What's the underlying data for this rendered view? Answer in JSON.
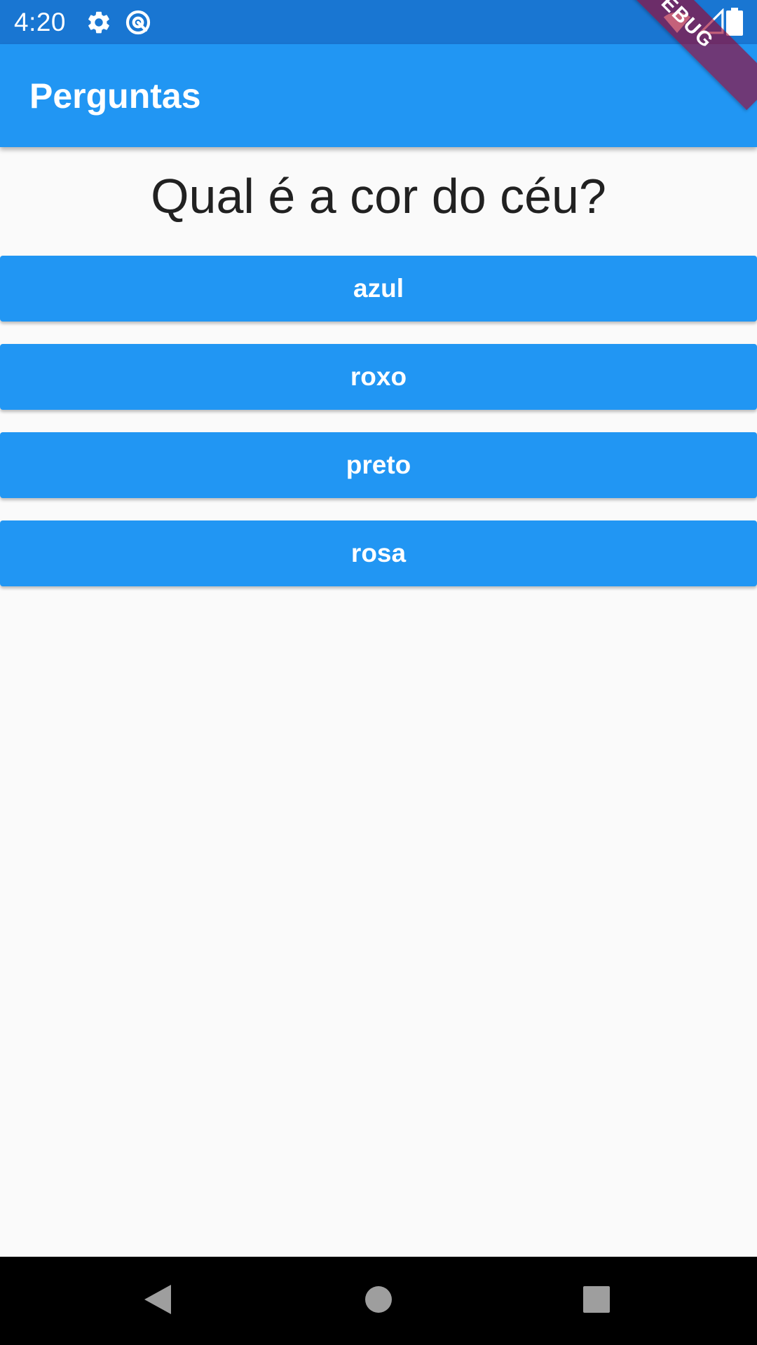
{
  "status_bar": {
    "time": "4:20",
    "icons": [
      "gear-icon",
      "at-sign-icon",
      "wifi-icon",
      "signal-icon",
      "battery-icon"
    ]
  },
  "app_bar": {
    "title": "Perguntas"
  },
  "debug_banner": {
    "label": "DEBUG"
  },
  "main": {
    "question": "Qual é a cor do céu?",
    "answers": [
      {
        "label": "azul"
      },
      {
        "label": "roxo"
      },
      {
        "label": "preto"
      },
      {
        "label": "rosa"
      }
    ]
  },
  "nav_bar": {
    "buttons": [
      "back-icon",
      "home-icon",
      "recents-icon"
    ]
  },
  "colors": {
    "status_bar": "#1976D2",
    "primary": "#2196F3",
    "background": "#FAFAFA",
    "text": "#212121",
    "debug_banner": "#A00028"
  }
}
